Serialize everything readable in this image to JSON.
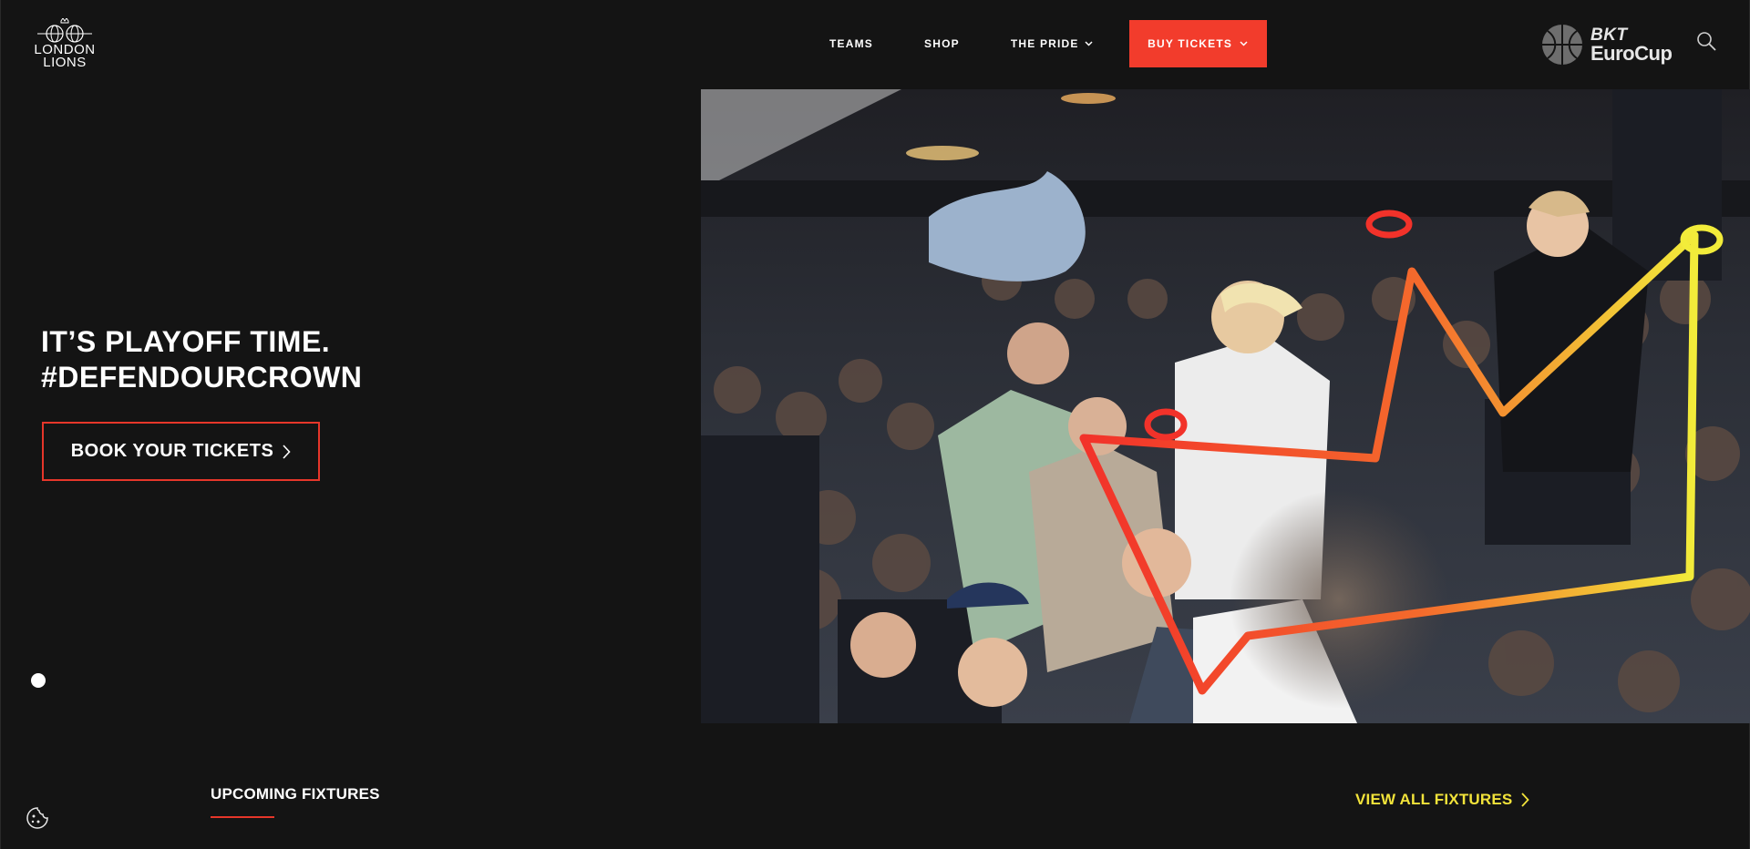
{
  "header": {
    "logo_line1": "LONDON",
    "logo_line2": "LIONS",
    "nav": {
      "teams": "TEAMS",
      "shop": "SHOP",
      "pride": "THE PRIDE",
      "buy_tickets": "BUY TICKETS"
    },
    "partner_line1": "BKT",
    "partner_line2": "EuroCup",
    "icons": {
      "search": "search-icon",
      "dropdown": "chevron-down-icon"
    }
  },
  "hero": {
    "headline_line1": "IT’S PLAYOFF TIME.",
    "headline_line2": "#DEFENDOURCROWN",
    "cta_label": "BOOK YOUR TICKETS",
    "slide_count": 1,
    "active_slide": 1
  },
  "fixtures": {
    "heading": "UPCOMING FIXTURES",
    "view_all": "VIEW ALL FIXTURES"
  },
  "colors": {
    "background": "#141414",
    "accent_red": "#f23c2c",
    "accent_yellow": "#f2e33a",
    "text": "#ffffff"
  }
}
